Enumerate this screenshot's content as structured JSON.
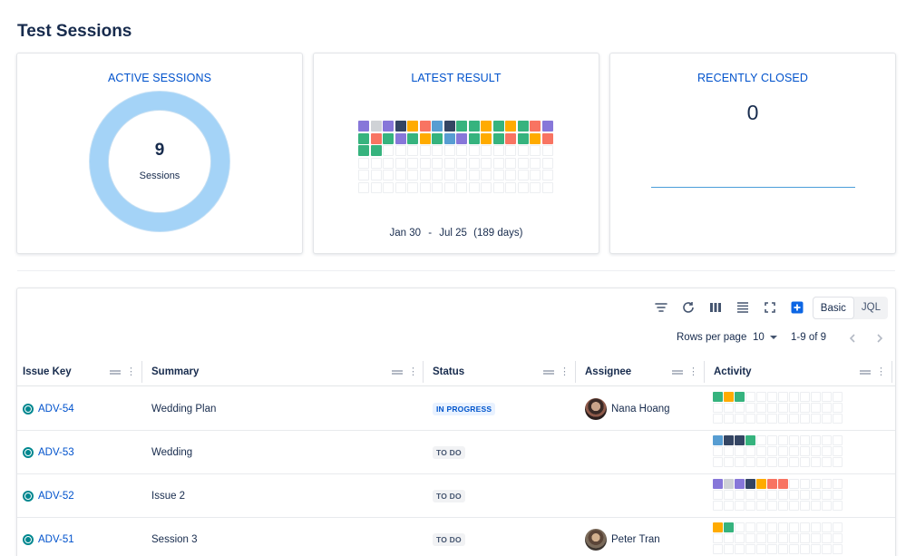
{
  "page": {
    "title": "Test Sessions"
  },
  "colors": {
    "accent": "#0052cc",
    "donut": "#a4d3f7",
    "palette": {
      "p": "#8777d9",
      "g": "#cfd2d6",
      "d": "#344563",
      "o": "#ffab00",
      "r": "#f87462",
      "b": "#579dd2",
      "n": "#36b37e"
    }
  },
  "cards": {
    "active": {
      "title": "ACTIVE SESSIONS",
      "value": "9",
      "label": "Sessions"
    },
    "latest": {
      "title": "LATEST RESULT",
      "date_start": "Jan 30",
      "date_sep": "-",
      "date_end": "Jul 25",
      "days": "(189 days)",
      "cells": [
        "p",
        "g",
        "p",
        "d",
        "o",
        "r",
        "b",
        "d",
        "n",
        "n",
        "o",
        "n",
        "o",
        "n",
        "r",
        "p",
        "n",
        "r",
        "n",
        "p",
        "n",
        "o",
        "n",
        "b",
        "p",
        "n",
        "o",
        "n",
        "r",
        "n",
        "o",
        "r",
        "n",
        "n"
      ]
    },
    "closed": {
      "title": "RECENTLY CLOSED",
      "value": "0"
    }
  },
  "toolbar": {
    "icons": [
      "filter-icon",
      "refresh-icon",
      "columns-icon",
      "density-icon",
      "fullscreen-icon",
      "add-icon"
    ],
    "mode_basic": "Basic",
    "mode_jql": "JQL"
  },
  "pagination": {
    "rows_label": "Rows per page",
    "rows_value": "10",
    "range": "1-9 of 9"
  },
  "table": {
    "columns": {
      "key": "Issue Key",
      "summary": "Summary",
      "status": "Status",
      "assignee": "Assignee",
      "activity": "Activity"
    },
    "rows": [
      {
        "key": "ADV-54",
        "summary": "Wedding Plan",
        "status": "IN PROGRESS",
        "status_kind": "progress",
        "assignee": "Nana Hoang",
        "avatar": "nana",
        "activity": [
          "n",
          "o",
          "n"
        ]
      },
      {
        "key": "ADV-53",
        "summary": "Wedding",
        "status": "TO DO",
        "status_kind": "todo",
        "assignee": "",
        "avatar": "",
        "activity": [
          "b",
          "d",
          "d",
          "n"
        ]
      },
      {
        "key": "ADV-52",
        "summary": "Issue 2",
        "status": "TO DO",
        "status_kind": "todo",
        "assignee": "",
        "avatar": "",
        "activity": [
          "p",
          "g",
          "p",
          "d",
          "o",
          "r",
          "r"
        ]
      },
      {
        "key": "ADV-51",
        "summary": "Session 3",
        "status": "TO DO",
        "status_kind": "todo",
        "assignee": "Peter Tran",
        "avatar": "peter",
        "activity": [
          "o",
          "n"
        ]
      }
    ]
  }
}
